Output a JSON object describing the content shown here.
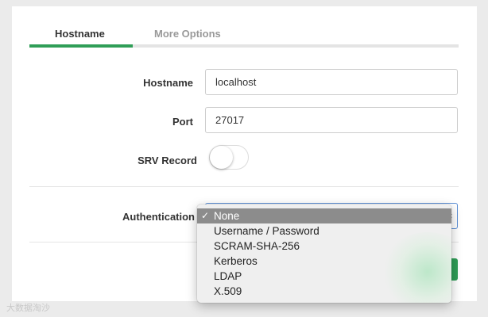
{
  "tabs": [
    {
      "label": "Hostname",
      "active": true
    },
    {
      "label": "More Options",
      "active": false
    }
  ],
  "form": {
    "hostname_label": "Hostname",
    "hostname_value": "localhost",
    "port_label": "Port",
    "port_value": "27017",
    "srv_label": "SRV Record",
    "srv_enabled": false,
    "auth_label": "Authentication"
  },
  "auth_options": [
    "None",
    "Username / Password",
    "SCRAM-SHA-256",
    "Kerberos",
    "LDAP",
    "X.509"
  ],
  "auth_selected": "None",
  "check_glyph": "✓",
  "watermark": "大数据淘沙",
  "colors": {
    "accent": "#2f9e57",
    "focus": "#5b8fd6",
    "selected_option_bg": "#8c8c8c"
  }
}
